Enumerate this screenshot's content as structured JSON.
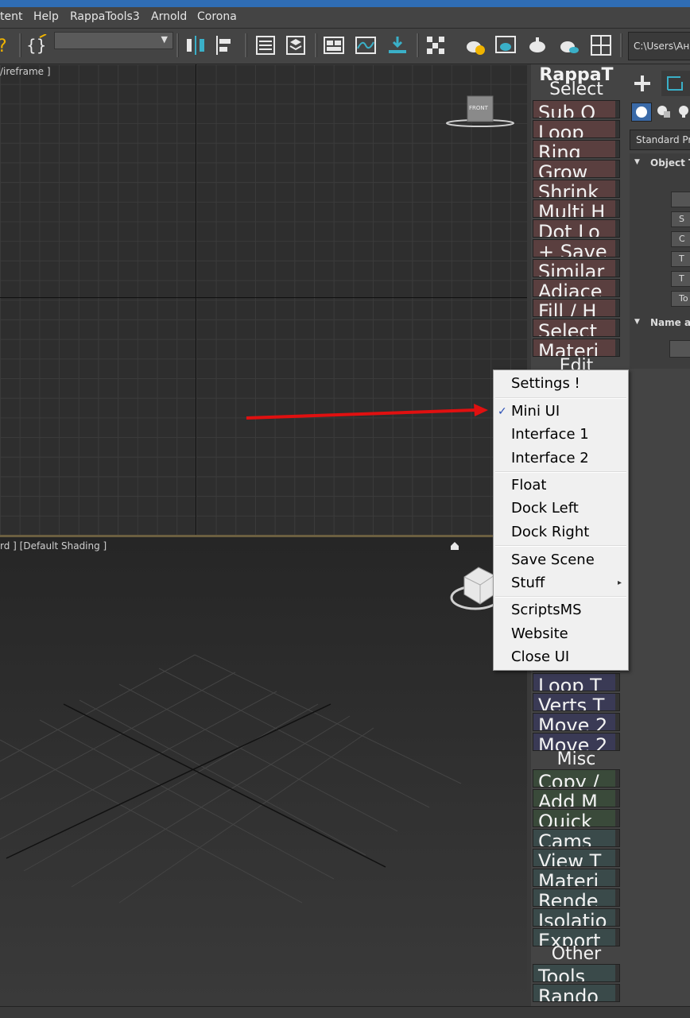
{
  "menubar": {
    "items": [
      "tent",
      "Help",
      "RappaTools3",
      "Arnold",
      "Corona"
    ]
  },
  "toolbar": {
    "path": "C:\\Users\\Ан"
  },
  "viewports": {
    "top_label": "/ireframe ]",
    "persp_label": "rd ]  [Default Shading ]",
    "viewcube_top_face": "FRONT"
  },
  "rappa": {
    "header": "RappaT",
    "select_heading": "Select",
    "select_buttons": [
      "Sub O",
      "Loop",
      "Ring",
      "Grow",
      "Shrink",
      "Multi H",
      "Dot Lo",
      "+ Save",
      "Similar",
      "Adjace",
      "Fill / H",
      "Select",
      "Materi"
    ],
    "edit_heading": "Edit",
    "edit_buttons": [
      "Loop T",
      "Verts T",
      "Move 2",
      "Move 2"
    ],
    "misc_heading": "Misc",
    "misc_buttons": [
      "Copy /",
      "Add M",
      "Quick",
      "Cams",
      "View T",
      "Materi",
      "Rende",
      "Isolatio",
      "Export"
    ],
    "other_heading": "Other",
    "other_buttons": [
      "Tools",
      "Rando"
    ]
  },
  "command_panel": {
    "dropdown": "Standard Pr",
    "rollout_1": "Object T",
    "rollout_2": "Name a",
    "small_buttons": [
      "S",
      "C",
      "T",
      "T",
      "To"
    ]
  },
  "context_menu": {
    "items": [
      {
        "label": "Settings !",
        "checked": false,
        "submenu": false
      },
      {
        "label": "Mini UI",
        "checked": true,
        "submenu": false
      },
      {
        "label": "Interface 1",
        "checked": false,
        "submenu": false
      },
      {
        "label": "Interface 2",
        "checked": false,
        "submenu": false
      },
      {
        "label": "Float",
        "checked": false,
        "submenu": false
      },
      {
        "label": "Dock Left",
        "checked": false,
        "submenu": false
      },
      {
        "label": "Dock Right",
        "checked": false,
        "submenu": false
      },
      {
        "label": "Save Scene",
        "checked": false,
        "submenu": false
      },
      {
        "label": "Stuff",
        "checked": false,
        "submenu": true
      },
      {
        "label": "ScriptsMS",
        "checked": false,
        "submenu": false
      },
      {
        "label": "Website",
        "checked": false,
        "submenu": false
      },
      {
        "label": "Close UI",
        "checked": false,
        "submenu": false
      }
    ],
    "check_glyph": "✓",
    "submenu_glyph": "▸"
  },
  "colors": {
    "annotation_arrow": "#e01010",
    "accent": "#2f6db5"
  }
}
